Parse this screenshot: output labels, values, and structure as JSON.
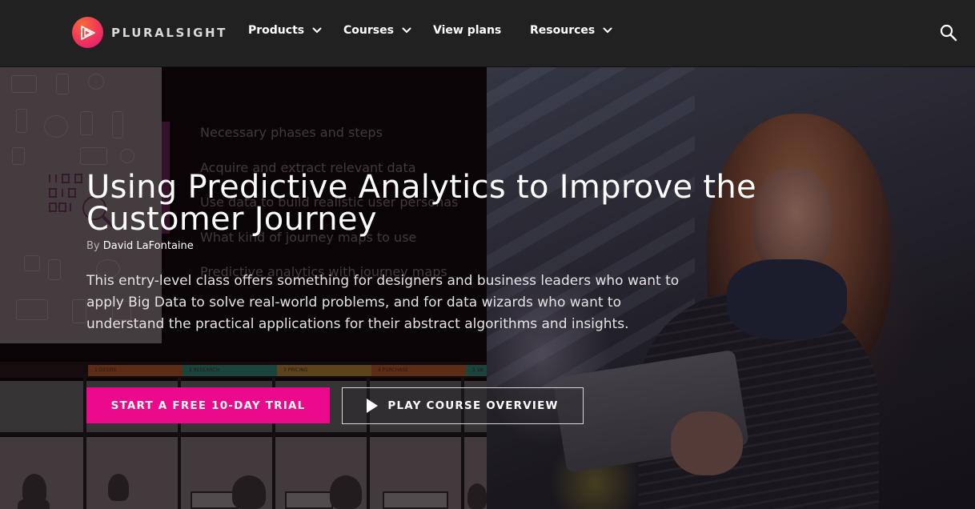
{
  "brand": {
    "name": "PLURALSIGHT",
    "logo_gradient": [
      "#f7693a",
      "#e0157f"
    ]
  },
  "nav": {
    "items": [
      {
        "label": "Products",
        "has_dropdown": true,
        "icon": "chevron-down-icon"
      },
      {
        "label": "Courses",
        "has_dropdown": true,
        "icon": "chevron-down-icon"
      },
      {
        "label": "View plans",
        "has_dropdown": false
      },
      {
        "label": "Resources",
        "has_dropdown": true,
        "icon": "chevron-down-icon"
      }
    ],
    "search_icon": "search-icon"
  },
  "hero": {
    "title": "Using Predictive Analytics to Improve the Customer Journey",
    "byline_prefix": "By",
    "author": "David LaFontaine",
    "description": "This entry-level class offers something for designers and business leaders who want to apply Big Data to solve real-world problems, and for data wizards who want to understand the practical applications for their abstract algorithms and insights.",
    "primary_cta": "START A FREE 10-DAY TRIAL",
    "secondary_cta": "PLAY COURSE OVERVIEW",
    "secondary_cta_icon": "play-icon",
    "accent_color": "#ec0a8c"
  },
  "background_slide": {
    "lines": [
      "Necessary phases and steps",
      "Acquire and extract relevant data",
      "Use data to build realistic user personas",
      "What kind of journey maps to use",
      "Predictive analytics with journey maps"
    ],
    "journey_stages": [
      {
        "label": "1  DESIRE",
        "color": "#7a3a1c"
      },
      {
        "label": "2  RESEARCH",
        "color": "#1f5a4f"
      },
      {
        "label": "3  PRICING",
        "color": "#7a5a22"
      },
      {
        "label": "4  PURCHASE",
        "color": "#7a3a1c"
      },
      {
        "label": "5  VA",
        "color": "#1f5a4f"
      }
    ]
  }
}
